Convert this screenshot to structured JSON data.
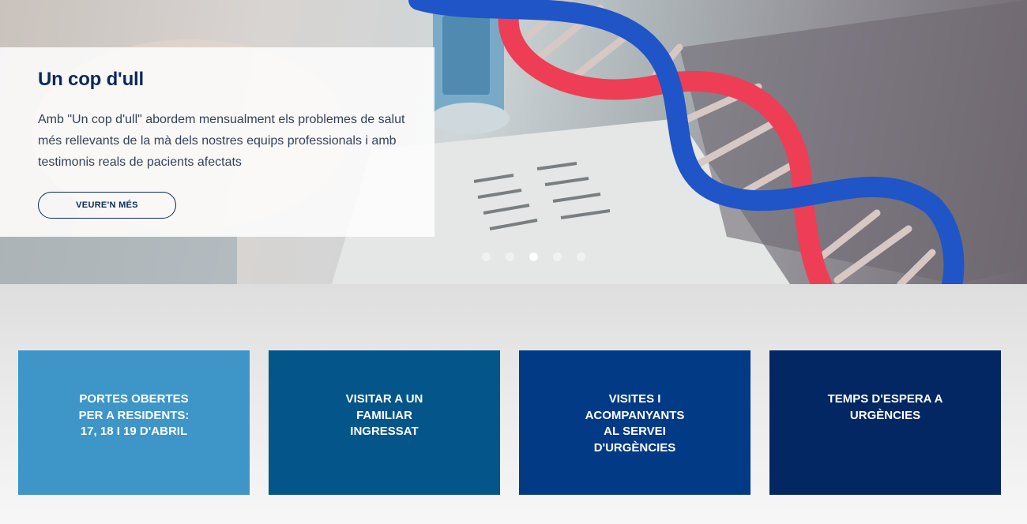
{
  "hero": {
    "title": "Un cop d'ull",
    "description": "Amb \"Un cop d'ull\" abordem mensualment els problemes de salut més rellevants de la mà dels nostres equips professionals i amb testimonis reals de pacients afectats",
    "button_label": "VEURE'N MÉS",
    "carousel": {
      "slide_count": 5,
      "active_index": 2
    }
  },
  "tiles": [
    {
      "label": "PORTES OBERTES\nPER A RESIDENTS:\n17, 18 I 19 D'ABRIL",
      "color": "#3d95c8"
    },
    {
      "label": "VISITAR A UN\nFAMILIAR\nINGRESSAT",
      "color": "#03558a"
    },
    {
      "label": "VISITES I\nACOMPANYANTS\nAL SERVEI\nD'URGÈNCIES",
      "color": "#033a86"
    },
    {
      "label": "TEMPS D'ESPERA A\nURGÈNCIES",
      "color": "#022763"
    }
  ]
}
